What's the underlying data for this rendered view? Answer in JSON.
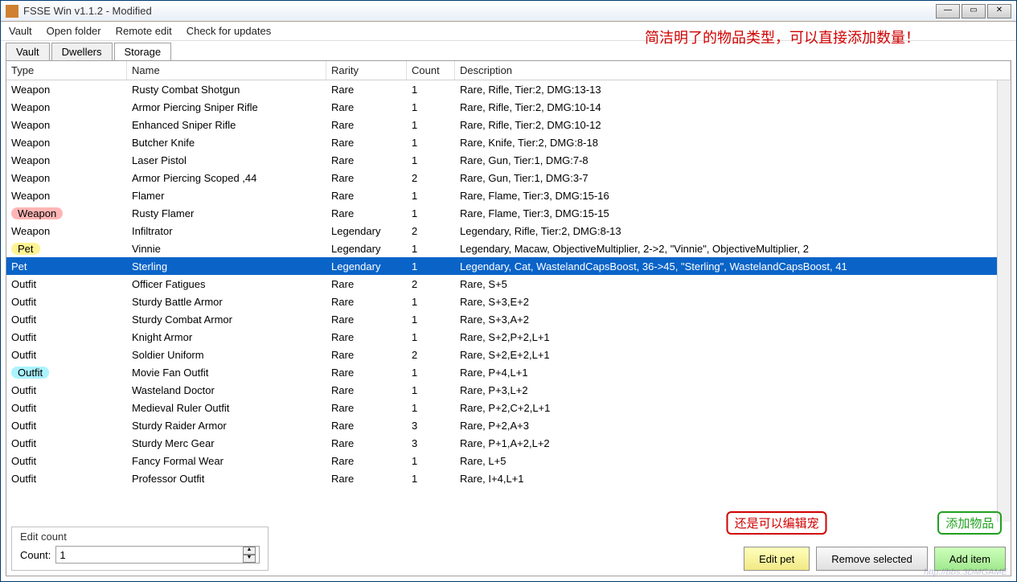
{
  "window": {
    "title": "FSSE Win v1.1.2 - Modified"
  },
  "menubar": [
    "Vault",
    "Open folder",
    "Remote edit",
    "Check for updates"
  ],
  "tabs": [
    {
      "label": "Vault",
      "active": false
    },
    {
      "label": "Dwellers",
      "active": false
    },
    {
      "label": "Storage",
      "active": true
    }
  ],
  "annotations": {
    "top_red": "简洁明了的物品类型，可以直接添加数量！",
    "edit_pet_red": "还是可以编辑宠",
    "add_item_green": "添加物品"
  },
  "table": {
    "headers": {
      "type": "Type",
      "name": "Name",
      "rarity": "Rarity",
      "count": "Count",
      "desc": "Description"
    },
    "rows": [
      {
        "type": "Weapon",
        "name": "Rusty Combat Shotgun",
        "rarity": "Rare",
        "count": "1",
        "desc": "Rare, Rifle, Tier:2, DMG:13-13"
      },
      {
        "type": "Weapon",
        "name": "Armor Piercing Sniper Rifle",
        "rarity": "Rare",
        "count": "1",
        "desc": "Rare, Rifle, Tier:2, DMG:10-14"
      },
      {
        "type": "Weapon",
        "name": "Enhanced Sniper Rifle",
        "rarity": "Rare",
        "count": "1",
        "desc": "Rare, Rifle, Tier:2, DMG:10-12"
      },
      {
        "type": "Weapon",
        "name": "Butcher Knife",
        "rarity": "Rare",
        "count": "1",
        "desc": "Rare, Knife, Tier:2, DMG:8-18"
      },
      {
        "type": "Weapon",
        "name": "Laser Pistol",
        "rarity": "Rare",
        "count": "1",
        "desc": "Rare, Gun, Tier:1, DMG:7-8"
      },
      {
        "type": "Weapon",
        "name": "Armor Piercing Scoped ,44",
        "rarity": "Rare",
        "count": "2",
        "desc": "Rare, Gun, Tier:1, DMG:3-7"
      },
      {
        "type": "Weapon",
        "name": "Flamer",
        "rarity": "Rare",
        "count": "1",
        "desc": "Rare, Flame, Tier:3, DMG:15-16"
      },
      {
        "type": "Weapon",
        "name": "Rusty Flamer",
        "rarity": "Rare",
        "count": "1",
        "desc": "Rare, Flame, Tier:3, DMG:15-15",
        "hl": "pink"
      },
      {
        "type": "Weapon",
        "name": "Infiltrator",
        "rarity": "Legendary",
        "count": "2",
        "desc": "Legendary, Rifle, Tier:2, DMG:8-13"
      },
      {
        "type": "Pet",
        "name": "Vinnie",
        "rarity": "Legendary",
        "count": "1",
        "desc": "Legendary, Macaw, ObjectiveMultiplier, 2->2, \"Vinnie\", ObjectiveMultiplier, 2",
        "hl": "yellow"
      },
      {
        "type": "Pet",
        "name": "Sterling",
        "rarity": "Legendary",
        "count": "1",
        "desc": "Legendary, Cat, WastelandCapsBoost, 36->45, \"Sterling\", WastelandCapsBoost, 41",
        "selected": true
      },
      {
        "type": "Outfit",
        "name": "Officer Fatigues",
        "rarity": "Rare",
        "count": "2",
        "desc": "Rare, S+5"
      },
      {
        "type": "Outfit",
        "name": "Sturdy Battle Armor",
        "rarity": "Rare",
        "count": "1",
        "desc": "Rare, S+3,E+2"
      },
      {
        "type": "Outfit",
        "name": "Sturdy Combat Armor",
        "rarity": "Rare",
        "count": "1",
        "desc": "Rare, S+3,A+2"
      },
      {
        "type": "Outfit",
        "name": "Knight Armor",
        "rarity": "Rare",
        "count": "1",
        "desc": "Rare, S+2,P+2,L+1"
      },
      {
        "type": "Outfit",
        "name": "Soldier Uniform",
        "rarity": "Rare",
        "count": "2",
        "desc": "Rare, S+2,E+2,L+1"
      },
      {
        "type": "Outfit",
        "name": "Movie Fan Outfit",
        "rarity": "Rare",
        "count": "1",
        "desc": "Rare, P+4,L+1",
        "hl": "cyan"
      },
      {
        "type": "Outfit",
        "name": "Wasteland Doctor",
        "rarity": "Rare",
        "count": "1",
        "desc": "Rare, P+3,L+2"
      },
      {
        "type": "Outfit",
        "name": "Medieval Ruler Outfit",
        "rarity": "Rare",
        "count": "1",
        "desc": "Rare, P+2,C+2,L+1"
      },
      {
        "type": "Outfit",
        "name": "Sturdy Raider Armor",
        "rarity": "Rare",
        "count": "3",
        "desc": "Rare, P+2,A+3"
      },
      {
        "type": "Outfit",
        "name": "Sturdy Merc Gear",
        "rarity": "Rare",
        "count": "3",
        "desc": "Rare, P+1,A+2,L+2"
      },
      {
        "type": "Outfit",
        "name": "Fancy Formal Wear",
        "rarity": "Rare",
        "count": "1",
        "desc": "Rare, L+5"
      },
      {
        "type": "Outfit",
        "name": "Professor Outfit",
        "rarity": "Rare",
        "count": "1",
        "desc": "Rare, I+4,L+1"
      }
    ]
  },
  "edit_count": {
    "group_label": "Edit count",
    "count_label": "Count:",
    "value": "1"
  },
  "buttons": {
    "edit_pet": "Edit pet",
    "remove_selected": "Remove selected",
    "add_item": "Add item"
  },
  "watermark": "http://bbs.3DMGAME"
}
